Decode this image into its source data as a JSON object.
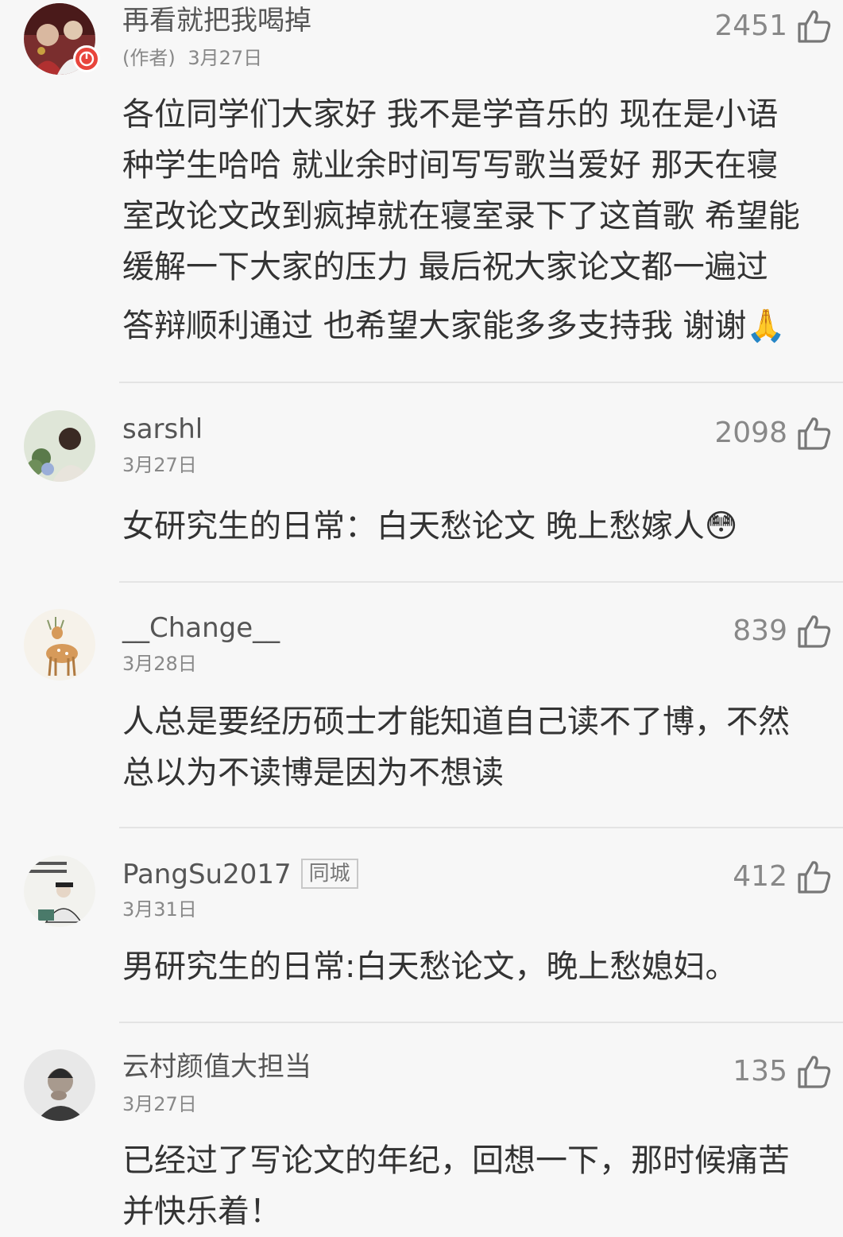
{
  "comments": [
    {
      "username": "再看就把我喝掉",
      "author_tag": "(作者)",
      "date": "3月27日",
      "likes": "2451",
      "lines": [
        "各位同学们大家好 我不是学音乐的 现在是小语",
        "种学生哈哈 就业余时间写写歌当爱好 那天在寝",
        "室改论文改到疯掉就在寝室录下了这首歌 希望能",
        "缓解一下大家的压力 最后祝大家论文都一遍过",
        "答辩顺利通过 也希望大家能多多支持我 谢谢🙏"
      ]
    },
    {
      "username": "sarshl",
      "date": "3月27日",
      "likes": "2098",
      "lines": [
        "女研究生的日常：白天愁论文 晚上愁嫁人😳"
      ]
    },
    {
      "username": "__Change__",
      "date": "3月28日",
      "likes": "839",
      "lines": [
        "人总是要经历硕士才能知道自己读不了博，不然",
        "总以为不读博是因为不想读"
      ]
    },
    {
      "username": "PangSu2017",
      "tag": "同城",
      "date": "3月31日",
      "likes": "412",
      "lines": [
        "男研究生的日常:白天愁论文，晚上愁媳妇。"
      ]
    },
    {
      "username": "云村颜值大担当",
      "date": "3月27日",
      "likes": "135",
      "lines": [
        "已经过了写论文的年纪，回想一下，那时候痛苦",
        "并快乐着！"
      ]
    }
  ],
  "icons": {
    "like": "thumbs-up-icon",
    "badge": "music-note-badge-icon"
  },
  "colors": {
    "background": "#f7f7f7",
    "text": "#333333",
    "secondary": "#888888",
    "badge": "#e8453c"
  }
}
